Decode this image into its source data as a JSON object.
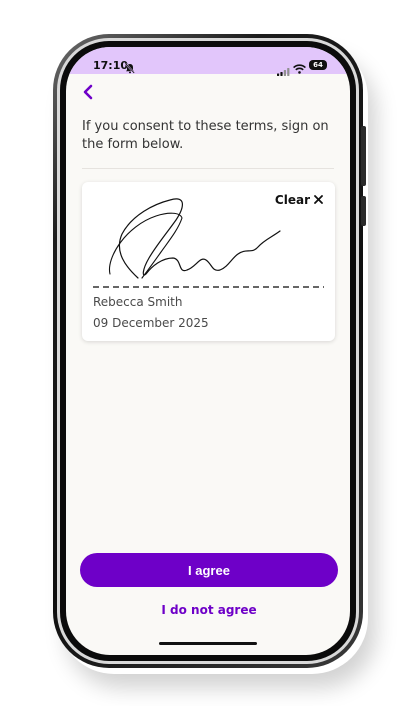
{
  "status_bar": {
    "time": "17:10",
    "battery": "64",
    "icons": [
      "bell-slash-icon",
      "signal-icon",
      "wifi-icon",
      "battery-icon"
    ],
    "background_color": "#e2c6fb"
  },
  "header": {
    "back_icon": "chevron-left-icon",
    "instruction": "If you consent to these terms, sign on the form below."
  },
  "signature_card": {
    "clear_label": "Clear",
    "clear_icon": "close-icon",
    "signer_name": "Rebecca Smith",
    "date": "09 December 2025"
  },
  "actions": {
    "agree_label": "I agree",
    "disagree_label": "I do not agree",
    "accent_color": "#6e00c8"
  }
}
